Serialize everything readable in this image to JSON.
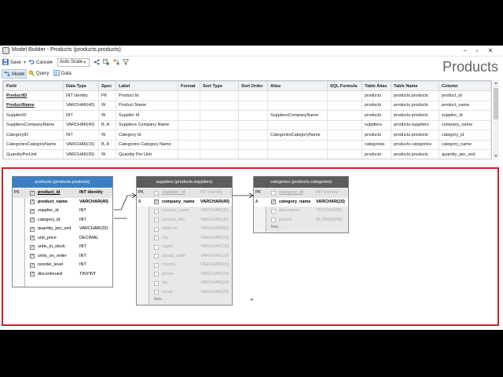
{
  "window": {
    "title": "Model Builder - Products (products.products)",
    "controls": [
      "–",
      "▫",
      "✕"
    ]
  },
  "toolbar": {
    "save_label": "Save",
    "cancel_label": "Cancel",
    "scale_value": "Auto Scale"
  },
  "tabs": [
    {
      "label": "Model"
    },
    {
      "label": "Query"
    },
    {
      "label": "Data"
    }
  ],
  "header": {
    "title": "Products"
  },
  "grid": {
    "columns": [
      "Field",
      "Data Type",
      "Spec",
      "Label",
      "Format",
      "Sort Type",
      "Sort Order",
      "Alias",
      "SQL Formula",
      "Table Alias",
      "Table Name",
      "Column"
    ],
    "rows": [
      [
        "ProductID",
        "INT identity",
        "PK",
        "Product Id",
        "",
        "",
        "",
        "",
        "",
        "products",
        "products.products",
        "product_id"
      ],
      [
        "ProductName",
        "VARCHAR(40)",
        "W",
        "Product Name",
        "",
        "",
        "",
        "",
        "",
        "products",
        "products.products",
        "product_name"
      ],
      [
        "SupplierID",
        "INT",
        "W",
        "Supplier Id",
        "",
        "",
        "",
        "SuppliersCompanyName",
        "",
        "products",
        "products.products",
        "supplier_id"
      ],
      [
        "SuppliersCompanyName",
        "VARCHAR(40)",
        "B, A",
        "Suppliers Company Name",
        "",
        "",
        "",
        "",
        "",
        "suppliers",
        "products.suppliers",
        "company_name"
      ],
      [
        "CategoryID",
        "INT",
        "W",
        "Category Id",
        "",
        "",
        "",
        "CategoriesCategoryName",
        "",
        "products",
        "products.products",
        "category_id"
      ],
      [
        "CategoriesCategoryName",
        "VARCHAR(15)",
        "B, A",
        "Categories Category Name",
        "",
        "",
        "",
        "",
        "",
        "categories",
        "products.categories",
        "category_name"
      ],
      [
        "QuantityPerUnit",
        "VARCHAR(20)",
        "W",
        "Quantity Per Unit",
        "",
        "",
        "",
        "",
        "",
        "products",
        "products.products",
        "quantity_per_unit"
      ]
    ]
  },
  "entities": {
    "products": {
      "title": "products (products.products)",
      "fields": [
        {
          "key": "PK",
          "name": "product_id",
          "type": "INT identity",
          "checked": true
        },
        {
          "key": "",
          "name": "product_name",
          "type": "VARCHAR(40)",
          "checked": true
        },
        {
          "key": "",
          "name": "supplier_id",
          "type": "INT",
          "checked": true
        },
        {
          "key": "",
          "name": "category_id",
          "type": "INT",
          "checked": true
        },
        {
          "key": "",
          "name": "quantity_per_unit",
          "type": "VARCHAR(20)",
          "checked": true
        },
        {
          "key": "",
          "name": "unit_price",
          "type": "DECIMAL",
          "checked": true
        },
        {
          "key": "",
          "name": "units_in_stock",
          "type": "INT",
          "checked": true
        },
        {
          "key": "",
          "name": "units_on_order",
          "type": "INT",
          "checked": true
        },
        {
          "key": "",
          "name": "reorder_level",
          "type": "INT",
          "checked": true
        },
        {
          "key": "",
          "name": "discontinued",
          "type": "TINYINT",
          "checked": true
        }
      ]
    },
    "suppliers": {
      "title": "suppliers (products.suppliers)",
      "fields": [
        {
          "key": "PK",
          "name": "supplier_id",
          "type": "INT identity",
          "checked": false
        },
        {
          "key": "A",
          "name": "company_name",
          "type": "VARCHAR(40)",
          "checked": true
        },
        {
          "key": "",
          "name": "contact_name",
          "type": "VARCHAR(30)",
          "checked": false
        },
        {
          "key": "",
          "name": "contact_title",
          "type": "VARCHAR(30)",
          "checked": false
        },
        {
          "key": "",
          "name": "address",
          "type": "VARCHAR(60)",
          "checked": false
        },
        {
          "key": "",
          "name": "city",
          "type": "VARCHAR(15)",
          "checked": false
        },
        {
          "key": "",
          "name": "region",
          "type": "VARCHAR(15)",
          "checked": false
        },
        {
          "key": "",
          "name": "postal_code",
          "type": "VARCHAR(10)",
          "checked": false
        },
        {
          "key": "",
          "name": "country",
          "type": "VARCHAR(15)",
          "checked": false
        },
        {
          "key": "",
          "name": "phone",
          "type": "VARCHAR(24)",
          "checked": false
        },
        {
          "key": "",
          "name": "fax",
          "type": "VARCHAR(24)",
          "checked": false
        },
        {
          "key": "",
          "name": "email",
          "type": "VARCHAR(25)",
          "checked": false
        }
      ],
      "less": "less..."
    },
    "categories": {
      "title": "categories (products.categories)",
      "fields": [
        {
          "key": "PK",
          "name": "category_id",
          "type": "INT identity",
          "checked": false
        },
        {
          "key": "A",
          "name": "category_name",
          "type": "VARCHAR(15)",
          "checked": true
        },
        {
          "key": "",
          "name": "description",
          "type": "TEXT(65535)",
          "checked": false
        },
        {
          "key": "",
          "name": "picture",
          "type": "BLOB(65535)",
          "checked": false
        }
      ],
      "less": "less..."
    }
  },
  "colors": {
    "active_header": "#3a7fc4",
    "inactive_header": "#5c5c5c",
    "diagram_border": "#c8202a"
  }
}
